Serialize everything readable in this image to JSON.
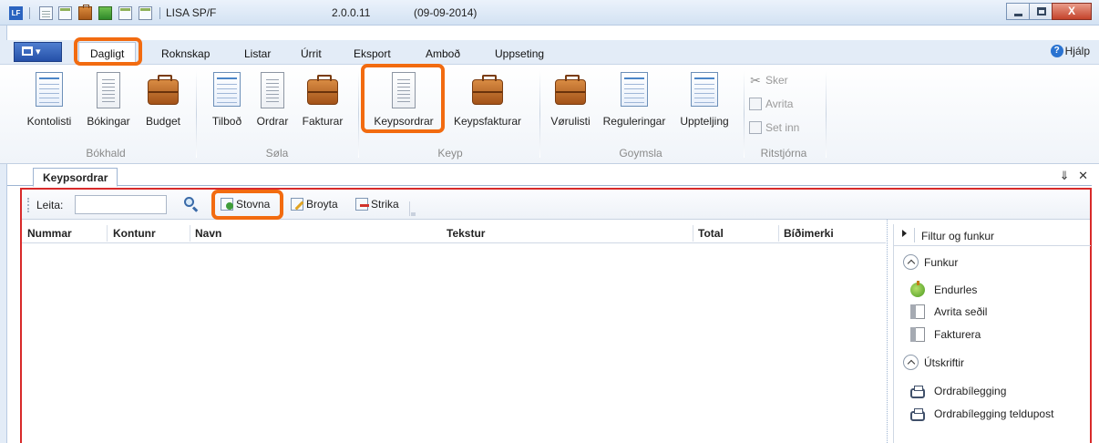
{
  "window": {
    "app_logo": "LF",
    "app_name": "LISA SP/F",
    "version": "2.0.0.11",
    "date": "(09-09-2014)",
    "close_glyph": "X"
  },
  "menu": {
    "tabs": [
      "Dagligt",
      "Rokn­skap",
      "Listar",
      "Úrrit",
      "Eksport",
      "Amboð",
      "Uppseting"
    ],
    "help": "Hjálp",
    "help_glyph": "?"
  },
  "ribbon": {
    "bokhald": {
      "group": "Bókhald",
      "buttons": [
        "Kontolisti",
        "Bókingar",
        "Budget"
      ]
    },
    "sola": {
      "group": "Søla",
      "buttons": [
        "Tilboð",
        "Ordrar",
        "Fakturar"
      ]
    },
    "keyp": {
      "group": "Keyp",
      "buttons": [
        "Keypsordrar",
        "Keypsfakturar"
      ]
    },
    "goymsla": {
      "group": "Goymsla",
      "buttons": [
        "Vørulisti",
        "Reguleringar",
        "Uppteljing"
      ]
    },
    "ritstjorna": {
      "group": "Ritstjórna",
      "buttons": [
        "Sker",
        "Avrita",
        "Set inn"
      ]
    }
  },
  "document": {
    "tab_title": "Keypsordrar",
    "pin_glyph": "⇓",
    "close_glyph": "✕"
  },
  "toolbar": {
    "search_label": "Leita:",
    "search_value": "",
    "add_label": "Stovna",
    "edit_label": "Broyta",
    "delete_label": "Strika"
  },
  "grid": {
    "columns": [
      "Nummar",
      "Kontunr",
      "Navn",
      "Tekstur",
      "Total",
      "Bíðimerki"
    ],
    "rows": []
  },
  "side_panel": {
    "header": "Filtur og funkur",
    "funkur": {
      "title": "Funkur",
      "items": [
        "Endurles",
        "Avrita seðil",
        "Fakturera"
      ]
    },
    "utskriftir": {
      "title": "Útskriftir",
      "items": [
        "Ordrabílegging",
        "Ordrabílegging teldupost"
      ]
    }
  },
  "colors": {
    "highlight": "#f26b10",
    "panel_border": "#d82a2a",
    "appbutton": "#2f5cb5"
  }
}
